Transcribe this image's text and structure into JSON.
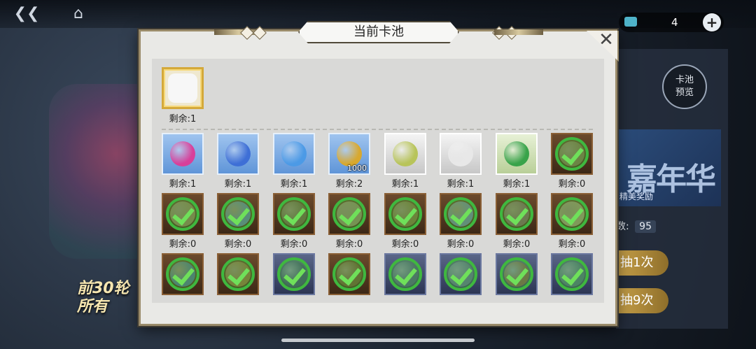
{
  "background": {
    "currency_value": "4",
    "pool_preview_label": "卡池\n预览",
    "banner_title": "嘉年华",
    "banner_subtitle": "精美奖励",
    "draw_count_label": "数:",
    "draw_count_value": "95",
    "draw_once_label": "抽1次",
    "draw_nine_label": "抽9次",
    "promo_line1": "前30轮",
    "promo_line2": "所有"
  },
  "modal": {
    "title": "当前卡池",
    "close_icon": "close-icon",
    "top_item": {
      "remaining": "剩余:1",
      "icon": "gold-frame-icon"
    },
    "rows": [
      [
        {
          "remaining": "剩余:1",
          "style": "blue",
          "icon": "pink-skull-gem-icon",
          "color": "#d8409a"
        },
        {
          "remaining": "剩余:1",
          "style": "blue",
          "icon": "blue-crystal-icon",
          "color": "#3e6fd6"
        },
        {
          "remaining": "剩余:1",
          "style": "blue",
          "icon": "blue-token-icon",
          "color": "#4c9ae6"
        },
        {
          "remaining": "剩余:2",
          "style": "blue",
          "icon": "gold-coin-icon",
          "color": "#d8a82e",
          "qty": "1000"
        },
        {
          "remaining": "剩余:1",
          "style": "white",
          "icon": "green-rag-icon",
          "color": "#b8c45a"
        },
        {
          "remaining": "剩余:1",
          "style": "white",
          "icon": "white-cloth-icon",
          "color": "#e8e8e8"
        },
        {
          "remaining": "剩余:1",
          "style": "green",
          "icon": "green-shard-icon",
          "color": "#39a34a"
        },
        {
          "remaining": "剩余:0",
          "style": "brown",
          "icon": "claimed-item-icon",
          "color": "#7b6a4a",
          "claimed": true
        }
      ],
      [
        {
          "remaining": "剩余:0",
          "style": "brown",
          "icon": "claimed-item-icon",
          "color": "#8a7654",
          "claimed": true
        },
        {
          "remaining": "剩余:0",
          "style": "brown",
          "icon": "claimed-item-icon",
          "color": "#5d7a9a",
          "claimed": true
        },
        {
          "remaining": "剩余:0",
          "style": "brown",
          "icon": "claimed-item-icon",
          "color": "#6a5a40",
          "claimed": true
        },
        {
          "remaining": "剩余:0",
          "style": "brown",
          "icon": "claimed-item-icon",
          "color": "#8a8060",
          "claimed": true
        },
        {
          "remaining": "剩余:0",
          "style": "brown",
          "icon": "claimed-item-icon",
          "color": "#7a6a3a",
          "claimed": true
        },
        {
          "remaining": "剩余:0",
          "style": "brown",
          "icon": "claimed-item-icon",
          "color": "#6c7c9a",
          "claimed": true
        },
        {
          "remaining": "剩余:0",
          "style": "brown",
          "icon": "claimed-item-icon",
          "color": "#7a5a5a",
          "claimed": true
        },
        {
          "remaining": "剩余:0",
          "style": "brown",
          "icon": "claimed-item-icon",
          "color": "#9a8a6a",
          "claimed": true
        }
      ],
      [
        {
          "remaining": "",
          "style": "brown",
          "icon": "claimed-item-icon",
          "color": "#4a6a8a",
          "claimed": true
        },
        {
          "remaining": "",
          "style": "brown",
          "icon": "claimed-item-icon",
          "color": "#8a6a3a",
          "claimed": true
        },
        {
          "remaining": "",
          "style": "navy",
          "icon": "claimed-item-icon",
          "color": "#3a4a6a",
          "claimed": true
        },
        {
          "remaining": "",
          "style": "brown",
          "icon": "claimed-item-icon",
          "color": "#6a5030",
          "claimed": true
        },
        {
          "remaining": "",
          "style": "navy",
          "icon": "claimed-item-icon",
          "color": "#4a5a7a",
          "claimed": true
        },
        {
          "remaining": "",
          "style": "navy",
          "icon": "claimed-item-icon",
          "color": "#5a6a8a",
          "claimed": true
        },
        {
          "remaining": "",
          "style": "navy",
          "icon": "claimed-item-icon",
          "color": "#7a5a4a",
          "claimed": true
        },
        {
          "remaining": "",
          "style": "navy",
          "icon": "claimed-item-icon",
          "color": "#4a6a7a",
          "claimed": true
        }
      ]
    ]
  }
}
